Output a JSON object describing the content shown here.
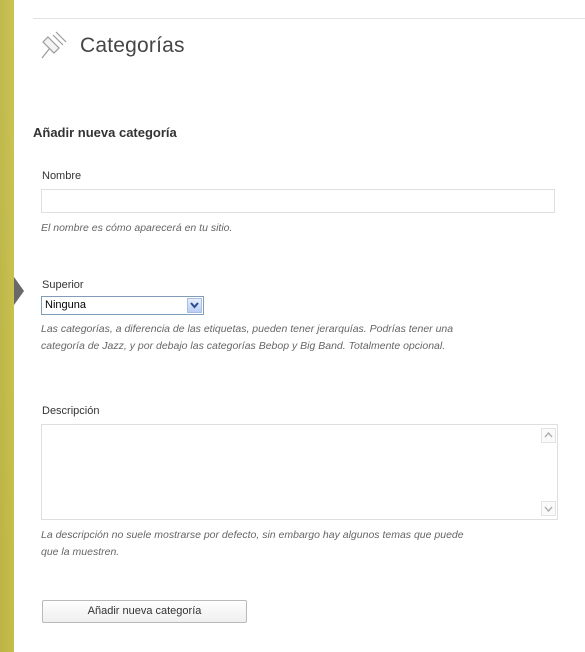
{
  "page": {
    "title": "Categorías",
    "title_icon": "pin-icon"
  },
  "form": {
    "section_title": "Añadir nueva categoría",
    "name": {
      "label": "Nombre",
      "value": "",
      "hint": "El nombre es cómo aparecerá en tu sitio."
    },
    "parent": {
      "label": "Superior",
      "selected": "Ninguna",
      "hint_line1": "Las categorías, a diferencia de las etiquetas, pueden tener jerarquías. Podrías tener una",
      "hint_line2": "categoría de Jazz, y por debajo las categorías Bebop y Big Band. Totalmente opcional."
    },
    "description": {
      "label": "Descripción",
      "value": "",
      "hint_line1": "La descripción no suele mostrarse por defecto, sin embargo hay algunos temas que puede",
      "hint_line2": "que la muestren."
    },
    "submit_label": "Añadir nueva categoría"
  },
  "colors": {
    "background": "#c7c04b",
    "panel": "#ffffff",
    "text": "#464646",
    "hint": "#666666"
  }
}
